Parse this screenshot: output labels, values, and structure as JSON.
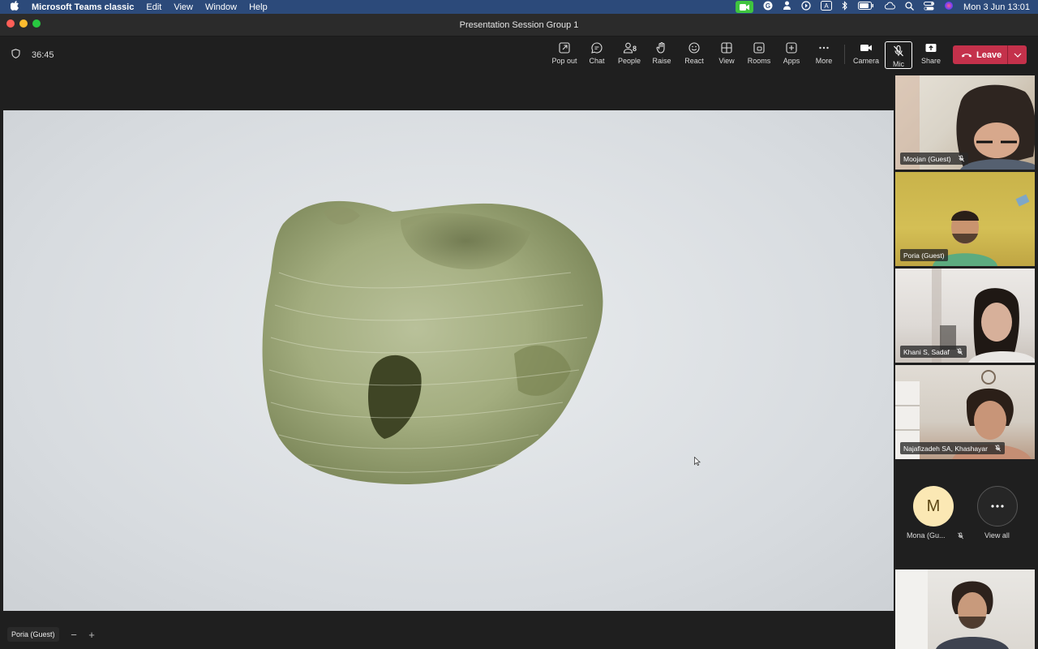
{
  "menubar": {
    "app_name": "Microsoft Teams classic",
    "menus": [
      "Edit",
      "View",
      "Window",
      "Help"
    ],
    "clock": "Mon 3 Jun  13:01",
    "status_icons": [
      "facetime-icon",
      "grammarly-icon",
      "person-icon",
      "play-circle-icon",
      "keyboard-a-icon",
      "bluetooth-icon",
      "battery-icon",
      "cloud-icon",
      "search-icon",
      "control-center-icon",
      "siri-icon"
    ]
  },
  "window": {
    "title": "Presentation Session Group 1",
    "traffic_lights": [
      "#ff5f57",
      "#febc2e",
      "#28c840"
    ]
  },
  "toolbar": {
    "timer": "36:45",
    "buttons": [
      {
        "label": "Pop out",
        "icon": "pop-out-icon"
      },
      {
        "label": "Chat",
        "icon": "chat-icon"
      },
      {
        "label": "People",
        "icon": "people-icon",
        "count": "8"
      },
      {
        "label": "Raise",
        "icon": "raise-hand-icon"
      },
      {
        "label": "React",
        "icon": "react-icon"
      },
      {
        "label": "View",
        "icon": "view-icon"
      },
      {
        "label": "Rooms",
        "icon": "rooms-icon"
      },
      {
        "label": "Apps",
        "icon": "apps-icon"
      },
      {
        "label": "More",
        "icon": "more-icon"
      },
      {
        "label": "Camera",
        "icon": "camera-icon"
      },
      {
        "label": "Mic",
        "icon": "mic-off-icon"
      },
      {
        "label": "Share",
        "icon": "share-icon"
      }
    ],
    "leave_label": "Leave",
    "leave_color": "#c4314b"
  },
  "stage": {
    "presenter_name": "Poria (Guest)",
    "zoom_out": "−",
    "zoom_in": "+"
  },
  "participants": [
    {
      "name": "Moojan (Guest)",
      "muted": true
    },
    {
      "name": "Poria (Guest)",
      "muted": false
    },
    {
      "name": "Khani S, Sadaf",
      "muted": true
    },
    {
      "name": "Najafizadeh SA, Khashayar",
      "muted": true
    }
  ],
  "mona": {
    "initial": "M",
    "name": "Mona (Gu...",
    "muted": true
  },
  "view_all": {
    "label": "View all"
  }
}
